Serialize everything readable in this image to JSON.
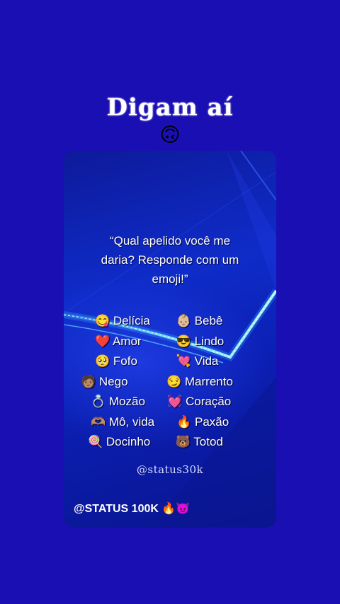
{
  "headline": "Digam aí",
  "headline_emoji": "🙃",
  "card": {
    "quote_line1": "“Qual apelido você me",
    "quote_line2": "daria? Responde com um",
    "quote_line3": "emoji!”",
    "options": [
      {
        "left": "😋 Delícia",
        "right": "👶🏼 Bebê"
      },
      {
        "left": "❤️ Amor",
        "right": "😎 Lindo"
      },
      {
        "left": "🥺 Fofo",
        "right": "💘 Vida"
      },
      {
        "left": "🧑🏽 Nego",
        "right": "😏 Marrento"
      },
      {
        "left": "💍 Mozão",
        "right": "💓 Coração"
      },
      {
        "left": "🫶🏽 Mô, vida",
        "right": "🔥 Paxão"
      },
      {
        "left": "🍭 Docinho",
        "right": "🐻 Totod"
      }
    ],
    "handle": "@status30k",
    "footer": "@STATUS 100K 🔥😈"
  }
}
